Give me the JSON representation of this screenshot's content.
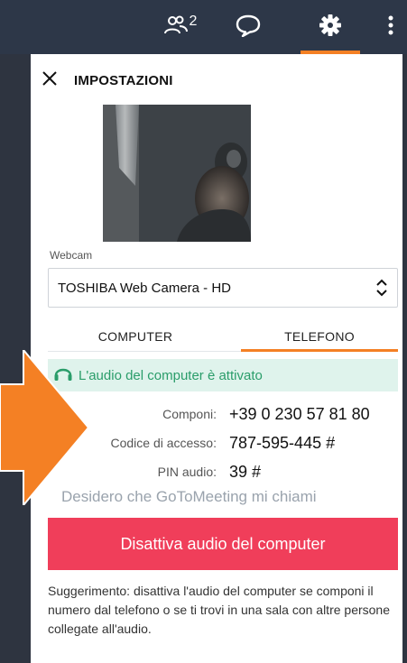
{
  "toolbar": {
    "participants_count": "2",
    "items": [
      "participants-icon",
      "chat-icon",
      "settings-icon",
      "more-icon"
    ],
    "active_color": "#f48024"
  },
  "panel": {
    "title": "IMPOSTAZIONI",
    "webcam_label": "Webcam",
    "webcam_selected": "TOSHIBA Web Camera - HD",
    "tabs": [
      "COMPUTER",
      "TELEFONO"
    ],
    "active_tab": "TELEFONO",
    "audio_status": "L'audio del computer è attivato",
    "rows": {
      "componi": {
        "label": "Componi:",
        "value": "+39 0 230 57 81 80"
      },
      "codice": {
        "label": "Codice di accesso:",
        "value": "787-595-445 #"
      },
      "pin": {
        "label": "PIN audio:",
        "value": "39 #"
      }
    },
    "call_me_link": "Desidero che GoToMeeting mi chiami",
    "disable_button": "Disattiva audio del computer",
    "tip": "Suggerimento: disattiva l'audio del computer se componi il numero dal telefono o se ti trovi in una sala con altre persone collegate all'audio."
  },
  "colors": {
    "accent_orange": "#f48024",
    "danger_red": "#f03e5a",
    "success_green": "#2a9d6a",
    "success_bg": "#dff3ec",
    "toolbar_bg": "#2d3748"
  }
}
